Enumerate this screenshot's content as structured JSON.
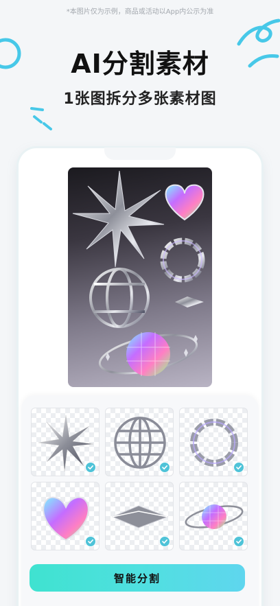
{
  "disclaimer": "*本图片仅为示例，商品或活动以App内公示为准",
  "title": "AI分割素材",
  "subtitle": "1张图拆分多张素材图",
  "colors": {
    "accent": "#4fc3d8",
    "button_start": "#3fe2d0",
    "button_end": "#5fd6ee",
    "decoration": "#47c8e8"
  },
  "hero": {
    "items": [
      "star-icon",
      "heart-icon",
      "chain-ring-icon",
      "globe-icon",
      "arrow-star-icon",
      "disco-ball-icon"
    ]
  },
  "tiles": [
    {
      "icon": "star-icon",
      "selected": true
    },
    {
      "icon": "globe-icon",
      "selected": true
    },
    {
      "icon": "chain-ring-icon",
      "selected": true
    },
    {
      "icon": "heart-icon",
      "selected": true
    },
    {
      "icon": "arrow-star-icon",
      "selected": true
    },
    {
      "icon": "disco-ball-icon",
      "selected": true
    }
  ],
  "button": {
    "label": "智能分割"
  }
}
